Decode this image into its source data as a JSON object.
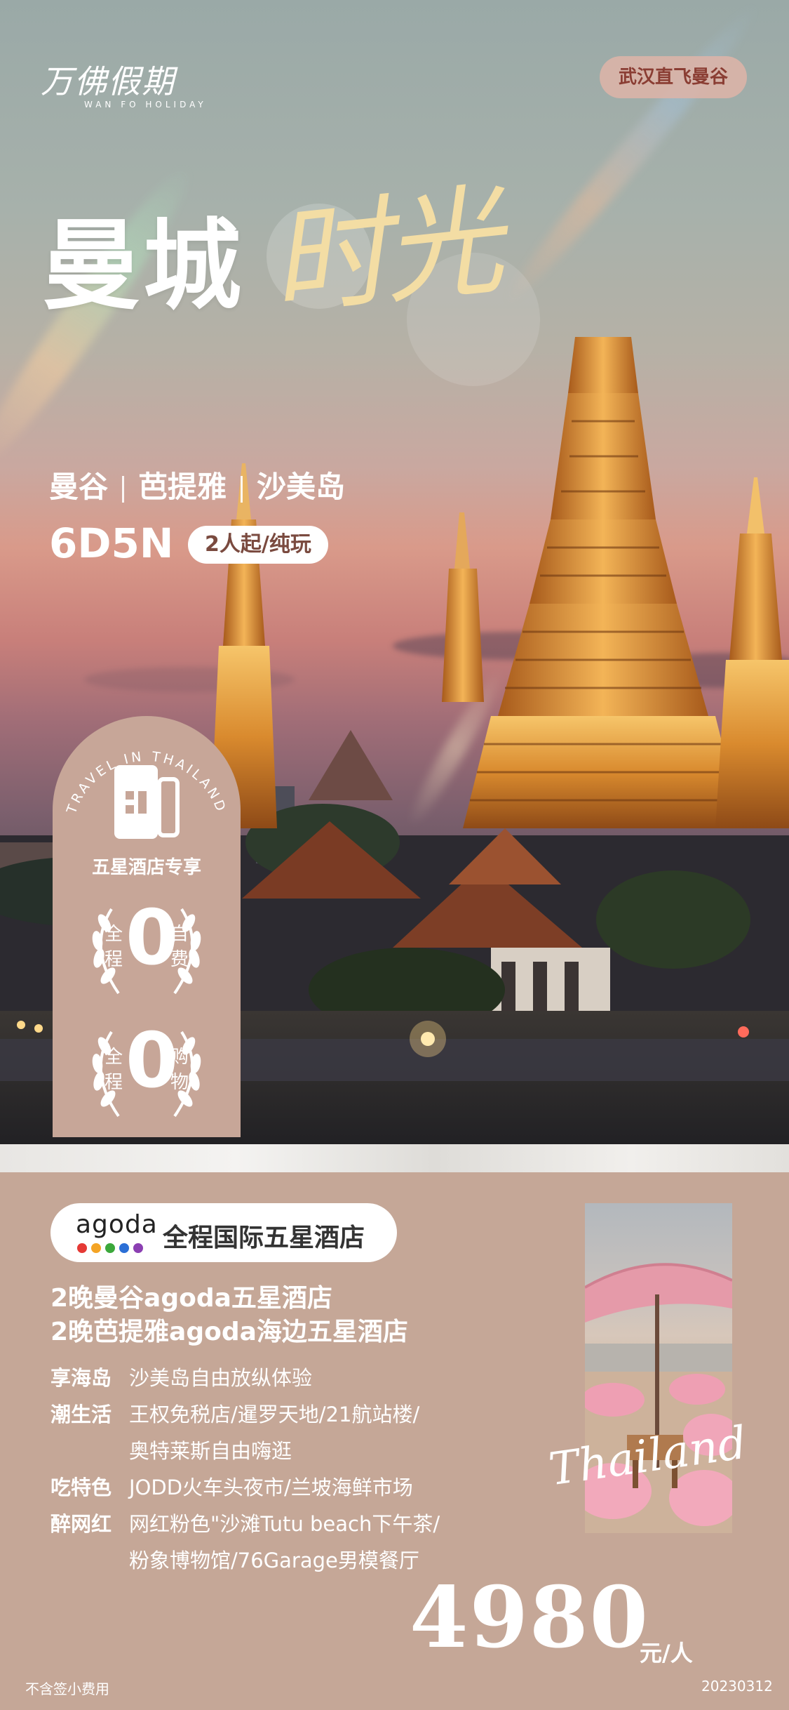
{
  "brand": {
    "logo_text": "万佛假期",
    "logo_sub": "WAN FO HOLIDAY"
  },
  "route_tag": "武汉直飞曼谷",
  "title": {
    "main": "曼城",
    "script": "时光"
  },
  "destinations": [
    "曼谷",
    "芭提雅",
    "沙美岛"
  ],
  "duration": {
    "code": "6D5N",
    "tag": "2人起/纯玩"
  },
  "badges": {
    "arc_text": "TRAVEL IN THAILAND",
    "hotel_label": "五星酒店专享",
    "zero_self": {
      "left": "全程",
      "number": "0",
      "right": "自费"
    },
    "zero_shop": {
      "left": "全程",
      "number": "0",
      "right": "购物"
    }
  },
  "hotel_section": {
    "agoda_word": "agoda",
    "agoda_title": "全程国际五星酒店",
    "agoda_dot_colors": [
      "#e53935",
      "#f4a425",
      "#3ba83b",
      "#2b6fd6",
      "#8b3fb2"
    ],
    "lines": [
      "2晚曼谷agoda五星酒店",
      "2晚芭提雅agoda海边五星酒店"
    ]
  },
  "features": [
    {
      "key": "享海岛",
      "value": "沙美岛自由放纵体验",
      "cont": ""
    },
    {
      "key": "潮生活",
      "value": "王权免税店/暹罗天地/21航站楼/",
      "cont": "奥特莱斯自由嗨逛"
    },
    {
      "key": "吃特色",
      "value": "JODD火车头夜市/兰坡海鲜市场",
      "cont": ""
    },
    {
      "key": "醉网红",
      "value": "网红粉色\"沙滩Tutu beach下午茶/",
      "cont": "粉象博物馆/76Garage男模餐厅"
    }
  ],
  "photo_script": "Thailand",
  "price": {
    "amount": "4980",
    "unit": "元/人"
  },
  "footnote": "不含签小费用",
  "date_code": "20230312",
  "colors": {
    "panel": "#c5a797",
    "title_gold": "#f3dda4",
    "route_text": "#8a3d33"
  }
}
